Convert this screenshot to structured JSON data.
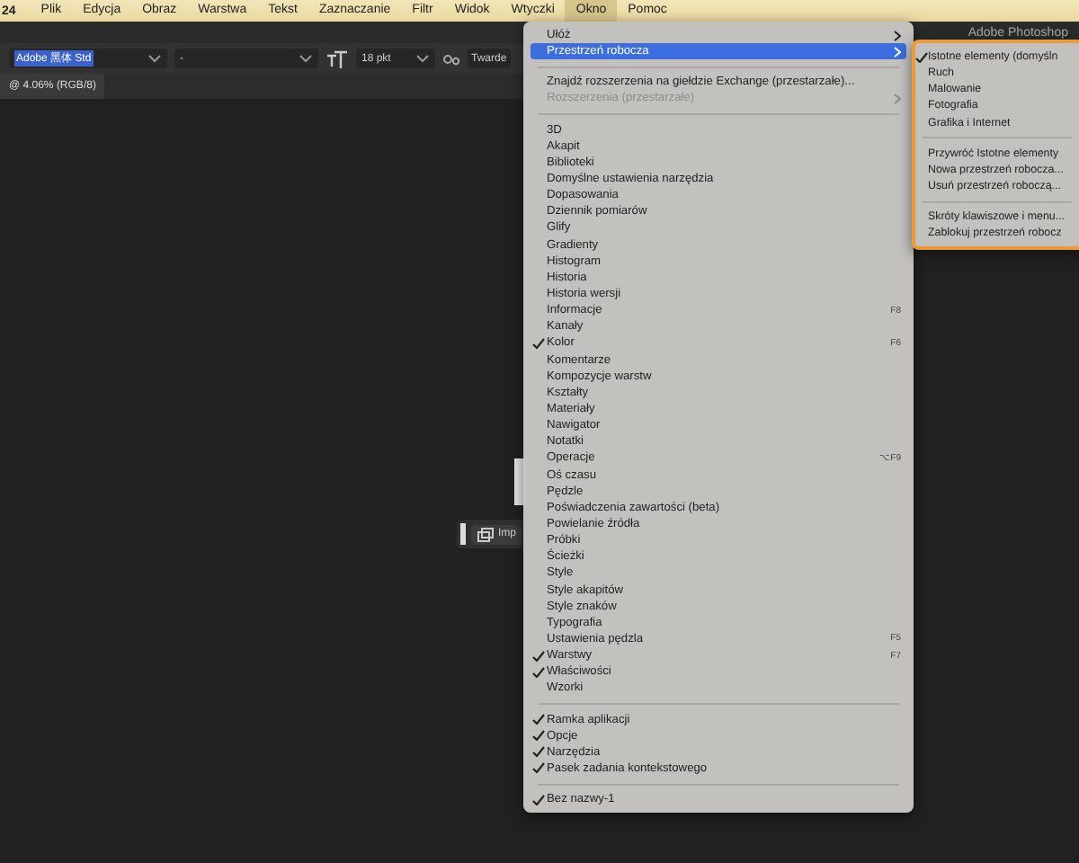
{
  "menubar": {
    "app_label": "24",
    "items": [
      {
        "label": "Plik",
        "selected": false
      },
      {
        "label": "Edycja",
        "selected": false
      },
      {
        "label": "Obraz",
        "selected": false
      },
      {
        "label": "Warstwa",
        "selected": false
      },
      {
        "label": "Tekst",
        "selected": false
      },
      {
        "label": "Zaznaczanie",
        "selected": false
      },
      {
        "label": "Filtr",
        "selected": false
      },
      {
        "label": "Widok",
        "selected": false
      },
      {
        "label": "Wtyczki",
        "selected": false
      },
      {
        "label": "Okno",
        "selected": true
      },
      {
        "label": "Pomoc",
        "selected": false
      }
    ]
  },
  "window_title": "Adobe Photoshop",
  "options_bar": {
    "font_family": {
      "value": "Adobe 黑体 Std",
      "selected": true
    },
    "font_style": {
      "value": "-"
    },
    "font_size": {
      "value": "18 pkt"
    },
    "antialias": {
      "value": "Twarde"
    }
  },
  "document_tab": {
    "title": "@ 4.06% (RGB/8)"
  },
  "context_taskbar": {
    "label": "Imp"
  },
  "menu": {
    "items": [
      {
        "kind": "item",
        "label": "Ułóż",
        "submenu": true
      },
      {
        "kind": "item",
        "label": "Przestrzeń robocza",
        "submenu": true,
        "selected": true
      },
      {
        "kind": "separator"
      },
      {
        "kind": "item",
        "label": "Znajdź rozszerzenia na giełdzie Exchange (przestarzałe)..."
      },
      {
        "kind": "item",
        "label": "Rozszerzenia (przestarzałe)",
        "submenu": true,
        "disabled": true
      },
      {
        "kind": "separator"
      },
      {
        "kind": "item",
        "label": "3D"
      },
      {
        "kind": "item",
        "label": "Akapit"
      },
      {
        "kind": "item",
        "label": "Biblioteki"
      },
      {
        "kind": "item",
        "label": "Domyślne ustawienia narzędzia"
      },
      {
        "kind": "item",
        "label": "Dopasowania"
      },
      {
        "kind": "item",
        "label": "Dziennik pomiarów"
      },
      {
        "kind": "item",
        "label": "Glify"
      },
      {
        "kind": "item",
        "label": "Gradienty"
      },
      {
        "kind": "item",
        "label": "Histogram"
      },
      {
        "kind": "item",
        "label": "Historia"
      },
      {
        "kind": "item",
        "label": "Historia wersji"
      },
      {
        "kind": "item",
        "label": "Informacje",
        "shortcut": "F8"
      },
      {
        "kind": "item",
        "label": "Kanały"
      },
      {
        "kind": "item",
        "label": "Kolor",
        "checked": true,
        "shortcut": "F6"
      },
      {
        "kind": "item",
        "label": "Komentarze"
      },
      {
        "kind": "item",
        "label": "Kompozycje warstw"
      },
      {
        "kind": "item",
        "label": "Kształty"
      },
      {
        "kind": "item",
        "label": "Materiały"
      },
      {
        "kind": "item",
        "label": "Nawigator"
      },
      {
        "kind": "item",
        "label": "Notatki"
      },
      {
        "kind": "item",
        "label": "Operacje",
        "shortcut": "⌥F9"
      },
      {
        "kind": "item",
        "label": "Oś czasu"
      },
      {
        "kind": "item",
        "label": "Pędzle"
      },
      {
        "kind": "item",
        "label": "Poświadczenia zawartości (beta)"
      },
      {
        "kind": "item",
        "label": "Powielanie źródła"
      },
      {
        "kind": "item",
        "label": "Próbki"
      },
      {
        "kind": "item",
        "label": "Ścieżki"
      },
      {
        "kind": "item",
        "label": "Style"
      },
      {
        "kind": "item",
        "label": "Style akapitów"
      },
      {
        "kind": "item",
        "label": "Style znaków"
      },
      {
        "kind": "item",
        "label": "Typografia"
      },
      {
        "kind": "item",
        "label": "Ustawienia pędzla",
        "shortcut": "F5"
      },
      {
        "kind": "item",
        "label": "Warstwy",
        "checked": true,
        "shortcut": "F7"
      },
      {
        "kind": "item",
        "label": "Właściwości",
        "checked": true
      },
      {
        "kind": "item",
        "label": "Wzorki"
      },
      {
        "kind": "separator"
      },
      {
        "kind": "item",
        "label": "Ramka aplikacji",
        "checked": true
      },
      {
        "kind": "item",
        "label": "Opcje",
        "checked": true
      },
      {
        "kind": "item",
        "label": "Narzędzia",
        "checked": true
      },
      {
        "kind": "item",
        "label": "Pasek zadania kontekstowego",
        "checked": true
      },
      {
        "kind": "separator"
      },
      {
        "kind": "item",
        "label": "Bez nazwy-1",
        "checked": true
      }
    ]
  },
  "submenu": {
    "items": [
      {
        "kind": "item",
        "label": "Istotne elementy (domyśln",
        "checked": true
      },
      {
        "kind": "item",
        "label": "Ruch"
      },
      {
        "kind": "item",
        "label": "Malowanie"
      },
      {
        "kind": "item",
        "label": "Fotografia"
      },
      {
        "kind": "item",
        "label": "Grafika i Internet"
      },
      {
        "kind": "separator"
      },
      {
        "kind": "item",
        "label": "Przywróć Istotne elementy"
      },
      {
        "kind": "item",
        "label": "Nowa przestrzeń robocza..."
      },
      {
        "kind": "item",
        "label": "Usuń przestrzeń roboczą..."
      },
      {
        "kind": "separator"
      },
      {
        "kind": "item",
        "label": "Skróty klawiszowe i menu..."
      },
      {
        "kind": "item",
        "label": "Zablokuj przestrzeń robocz"
      }
    ]
  }
}
